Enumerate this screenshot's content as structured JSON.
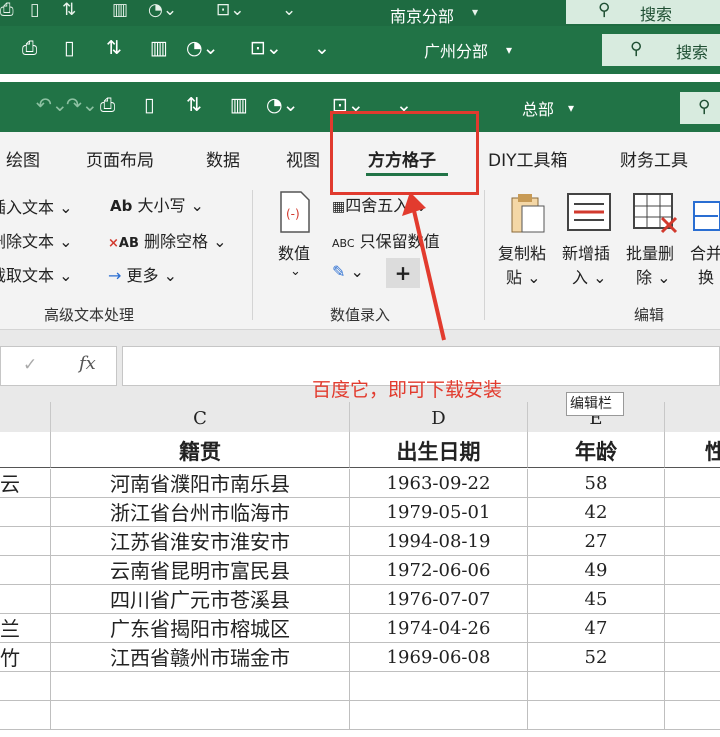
{
  "windows": [
    {
      "title": "南京分部",
      "search": "搜索"
    },
    {
      "title": "广州分部",
      "search": "搜索"
    },
    {
      "title": "总部",
      "search": ""
    }
  ],
  "tabs": [
    {
      "label": "绘图"
    },
    {
      "label": "页面布局"
    },
    {
      "label": "数据"
    },
    {
      "label": "视图"
    },
    {
      "label": "方方格子"
    },
    {
      "label": "DIY工具箱"
    },
    {
      "label": "财务工具"
    }
  ],
  "ribbon": {
    "text_group": {
      "insert": "插入文本",
      "delete": "删除文本",
      "extract": "截取文本",
      "case": "大小写",
      "delete_space": "删除空格",
      "more": "更多",
      "label": "高级文本处理"
    },
    "number_group": {
      "numeric": "数值",
      "round": "四舍五入",
      "keep": "只保留数值",
      "label": "数值录入"
    },
    "edit_group": {
      "copy_paste_1": "复制粘",
      "copy_paste_2": "贴",
      "new_insert_1": "新增插",
      "new_insert_2": "入",
      "batch_delete_1": "批量删",
      "batch_delete_2": "除",
      "merge_1": "合并",
      "merge_2": "换",
      "label": "编辑"
    }
  },
  "formula_bar": {
    "fx": "fx"
  },
  "annotation": "百度它，即可下载安装",
  "tooltip": "编辑栏",
  "columns": [
    "C",
    "D",
    "E"
  ],
  "table": {
    "headers": [
      "籍贯",
      "出生日期",
      "年龄",
      "性"
    ],
    "rows": [
      {
        "name": "云",
        "place": "河南省濮阳市南乐县",
        "date": "1963-09-22",
        "age": "58"
      },
      {
        "name": "",
        "place": "浙江省台州市临海市",
        "date": "1979-05-01",
        "age": "42"
      },
      {
        "name": "",
        "place": "江苏省淮安市淮安市",
        "date": "1994-08-19",
        "age": "27"
      },
      {
        "name": "",
        "place": "云南省昆明市富民县",
        "date": "1972-06-06",
        "age": "49"
      },
      {
        "name": "",
        "place": "四川省广元市苍溪县",
        "date": "1976-07-07",
        "age": "45"
      },
      {
        "name": "兰",
        "place": "广东省揭阳市榕城区",
        "date": "1974-04-26",
        "age": "47"
      },
      {
        "name": "竹",
        "place": "江西省赣州市瑞金市",
        "date": "1969-06-08",
        "age": "52"
      }
    ]
  },
  "colors": {
    "accent": "#217346",
    "annotation": "#e23b2e"
  }
}
